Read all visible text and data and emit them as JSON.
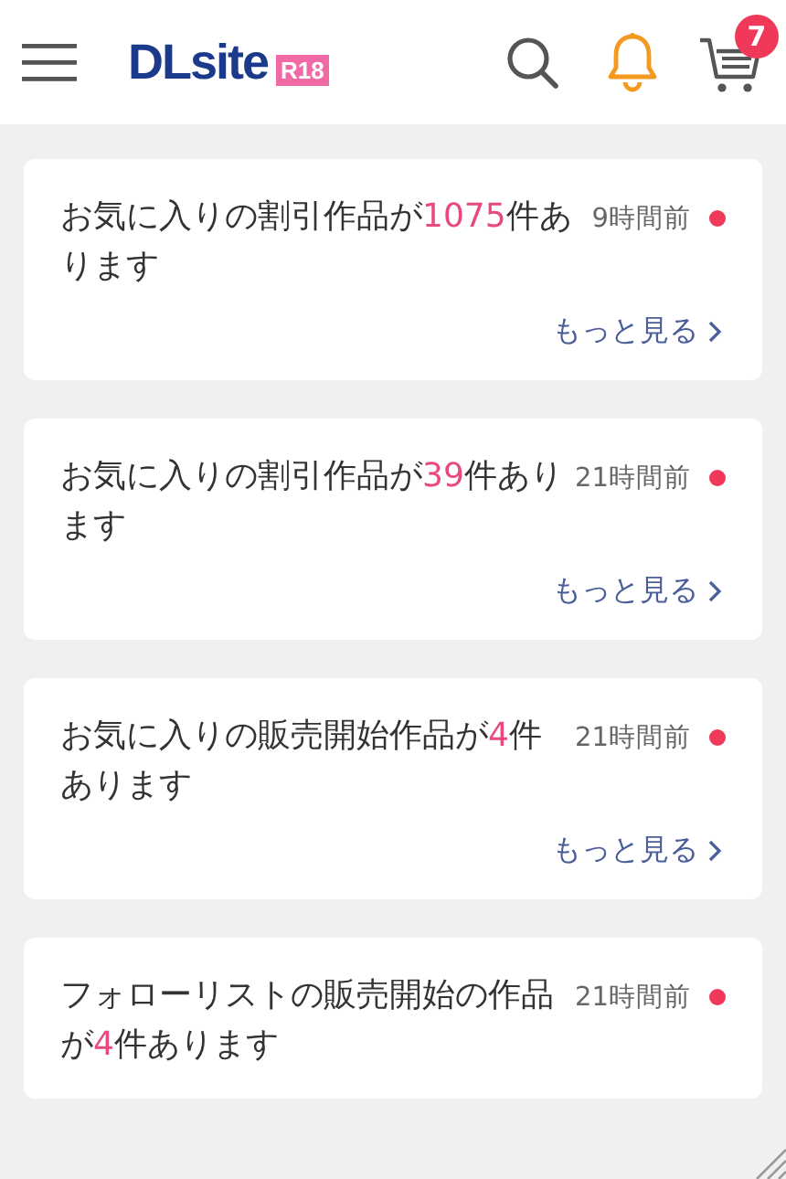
{
  "header": {
    "logo": "DLsite",
    "rating_badge": "R18",
    "cart_count": "7"
  },
  "notifications": [
    {
      "before": "お気に入りの割引作品が",
      "count": "1075",
      "after": "件あります",
      "time": "9時間前",
      "unread": true,
      "link": "もっと見る"
    },
    {
      "before": "お気に入りの割引作品が",
      "count": "39",
      "after": "件あります",
      "time": "21時間前",
      "unread": true,
      "link": "もっと見る"
    },
    {
      "before": "お気に入りの販売開始作品が",
      "count": "4",
      "after": "件あります",
      "time": "21時間前",
      "unread": true,
      "link": "もっと見る"
    },
    {
      "before": "フォローリストの販売開始の作品が",
      "count": "4",
      "after": "件あります",
      "time": "21時間前",
      "unread": true
    }
  ]
}
